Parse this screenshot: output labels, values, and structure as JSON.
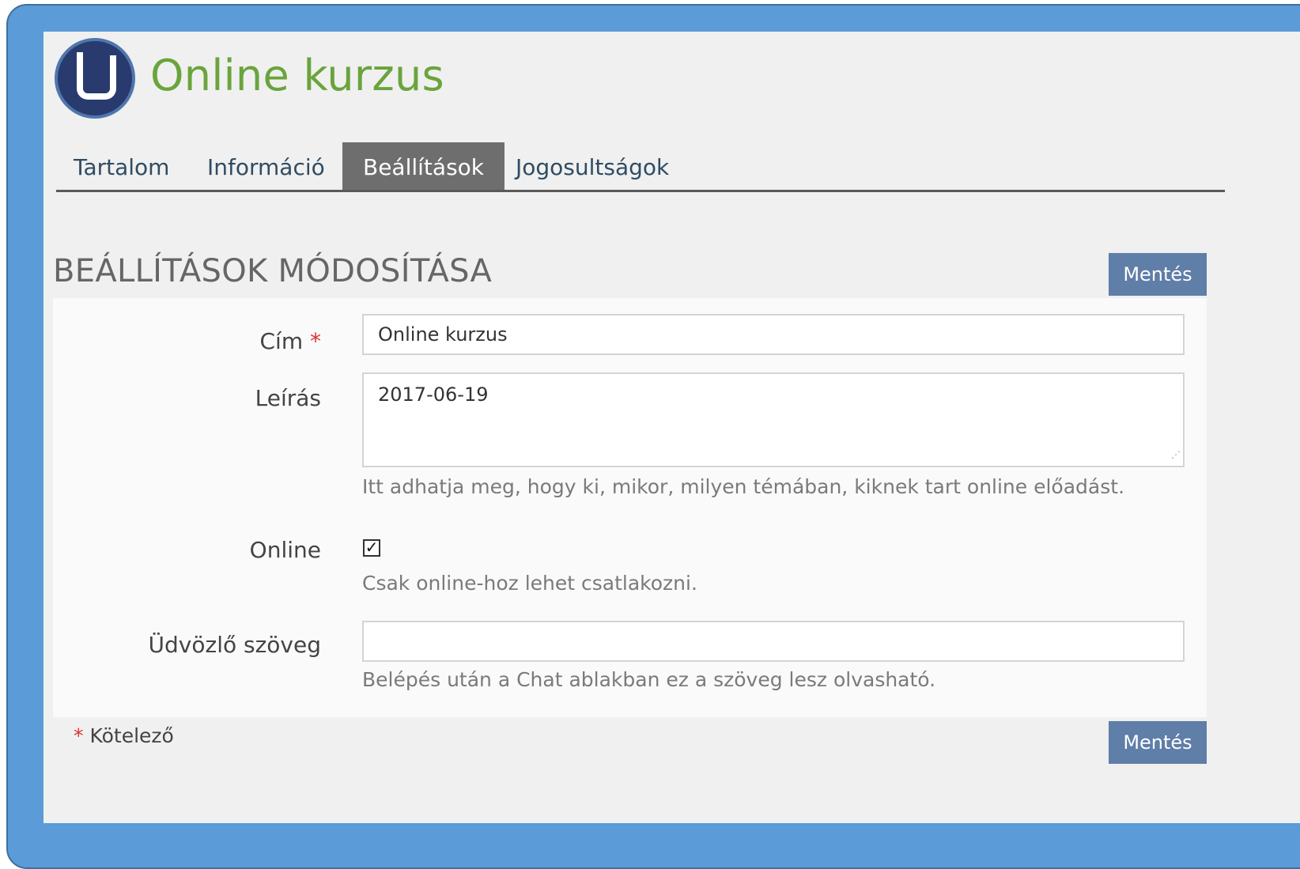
{
  "header": {
    "title": "Online kurzus"
  },
  "tabs": [
    {
      "label": "Tartalom"
    },
    {
      "label": "Információ"
    },
    {
      "label": "Beállítások",
      "active": true
    },
    {
      "label": "Jogosultságok"
    }
  ],
  "section": {
    "title": "BEÁLLÍTÁSOK MÓDOSÍTÁSA",
    "save_label": "Mentés"
  },
  "form": {
    "title_label": "Cím",
    "title_required_marker": "*",
    "title_value": "Online kurzus",
    "description_label": "Leírás",
    "description_value": "2017-06-19",
    "description_help": "Itt adhatja meg, hogy ki, mikor, milyen témában, kiknek tart online előadást.",
    "online_label": "Online",
    "online_checked": true,
    "online_help": "Csak online-hoz lehet csatlakozni.",
    "welcome_label": "Üdvözlő szöveg",
    "welcome_value": "",
    "welcome_help": "Belépés után a Chat ablakban ez a szöveg lesz olvasható."
  },
  "footer": {
    "required_marker": "*",
    "required_note": "Kötelező",
    "save_label": "Mentés"
  },
  "colors": {
    "frame": "#5a9bd8",
    "title": "#6aa43c",
    "active_tab": "#6e6e6e",
    "button": "#5f7ea8",
    "required": "#d33"
  },
  "icons": {
    "logo": "bigbluebutton-logo",
    "checkbox": "checkmark-icon",
    "resize": "textarea-resize-icon"
  }
}
